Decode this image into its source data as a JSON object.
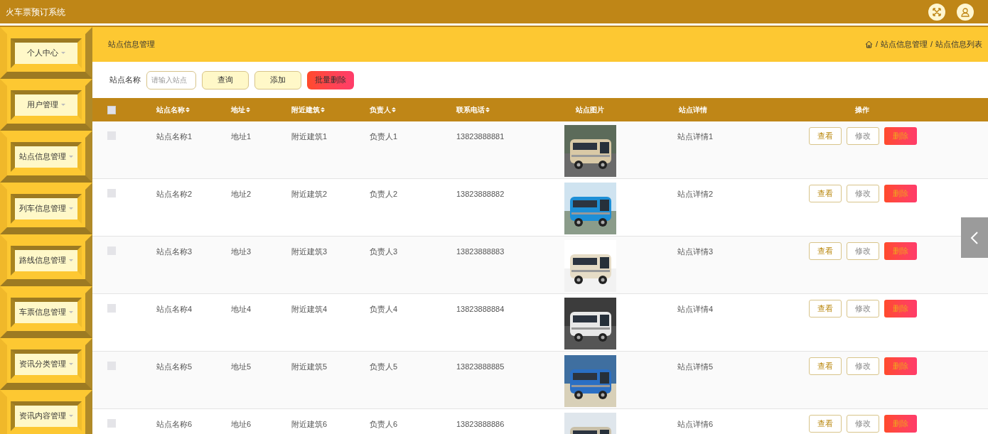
{
  "window": {
    "title": "火车票预订系统"
  },
  "sidebar": {
    "items": [
      {
        "label": "个人中心"
      },
      {
        "label": "用户管理"
      },
      {
        "label": "站点信息管理"
      },
      {
        "label": "列车信息管理"
      },
      {
        "label": "路线信息管理"
      },
      {
        "label": "车票信息管理"
      },
      {
        "label": "资讯分类管理"
      },
      {
        "label": "资讯内容管理"
      }
    ]
  },
  "page_title": "站点信息管理",
  "breadcrumb": [
    {
      "separator": "/",
      "label": "站点信息管理"
    },
    {
      "separator": "/",
      "label": "站点信息列表"
    }
  ],
  "search": {
    "label": "站点名称",
    "placeholder": "请输入站点",
    "buttons": [
      {
        "label": "查询",
        "kind": "normal"
      },
      {
        "label": "添加",
        "kind": "normal"
      },
      {
        "label": "批量删除",
        "kind": "danger"
      }
    ]
  },
  "table": {
    "select_all_checked": false,
    "columns": [
      {
        "label": "站点名称",
        "sortable": true
      },
      {
        "label": "地址",
        "sortable": true
      },
      {
        "label": "附近建筑",
        "sortable": true
      },
      {
        "label": "负责人",
        "sortable": true
      },
      {
        "label": "联系电话",
        "sortable": true
      },
      {
        "label": "站点图片",
        "sortable": false
      },
      {
        "label": "站点详情",
        "sortable": false
      },
      {
        "label": "操作",
        "sortable": false
      }
    ],
    "rows": [
      {
        "checked": false,
        "cells": [
          "站点名称1",
          "地址1",
          "附近建筑1",
          "负责人1",
          "13823888881"
        ],
        "picture": {
          "kind": "picture"
        },
        "detail": "站点详情1",
        "actions": [
          "查看",
          "修改",
          "删除"
        ]
      },
      {
        "checked": false,
        "cells": [
          "站点名称2",
          "地址2",
          "附近建筑2",
          "负责人2",
          "13823888882"
        ],
        "picture": {
          "kind": "picture"
        },
        "detail": "站点详情2",
        "actions": [
          "查看",
          "修改",
          "删除"
        ]
      },
      {
        "checked": false,
        "cells": [
          "站点名称3",
          "地址3",
          "附近建筑3",
          "负责人3",
          "13823888883"
        ],
        "picture": {
          "kind": "picture"
        },
        "detail": "站点详情3",
        "actions": [
          "查看",
          "修改",
          "删除"
        ]
      },
      {
        "checked": false,
        "cells": [
          "站点名称4",
          "地址4",
          "附近建筑4",
          "负责人4",
          "13823888884"
        ],
        "picture": {
          "kind": "picture"
        },
        "detail": "站点详情4",
        "actions": [
          "查看",
          "修改",
          "删除"
        ]
      },
      {
        "checked": false,
        "cells": [
          "站点名称5",
          "地址5",
          "附近建筑5",
          "负责人5",
          "13823888885"
        ],
        "picture": {
          "kind": "picture"
        },
        "detail": "站点详情5",
        "actions": [
          "查看",
          "修改",
          "删除"
        ]
      },
      {
        "checked": false,
        "cells": [
          "站点名称6",
          "地址6",
          "附近建筑6",
          "负责人6",
          "13823888886"
        ],
        "picture": {
          "kind": "picture"
        },
        "detail": "站点详情6",
        "actions": [
          "查看",
          "修改",
          "删除"
        ]
      }
    ]
  }
}
